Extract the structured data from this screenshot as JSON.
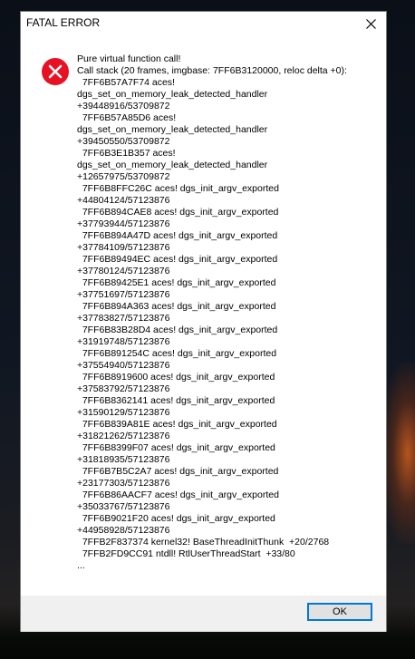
{
  "window": {
    "title": "FATAL ERROR"
  },
  "icons": {
    "close": "close-icon",
    "error": "error-icon"
  },
  "colors": {
    "error_red": "#e81123",
    "button_border": "#0078d7"
  },
  "message": {
    "lines": [
      "Pure virtual function call!",
      "Call stack (20 frames, imgbase: 7FF6B3120000, reloc delta +0):",
      "  7FF6B57A7F74 aces!",
      "dgs_set_on_memory_leak_detected_handler",
      "+39448916/53709872",
      "  7FF6B57A85D6 aces!",
      "dgs_set_on_memory_leak_detected_handler",
      "+39450550/53709872",
      "  7FF6B3E1B357 aces!",
      "dgs_set_on_memory_leak_detected_handler",
      "+12657975/53709872",
      "  7FF6B8FFC26C aces! dgs_init_argv_exported",
      "+44804124/57123876",
      "  7FF6B894CAE8 aces! dgs_init_argv_exported",
      "+37793944/57123876",
      "  7FF6B894A47D aces! dgs_init_argv_exported",
      "+37784109/57123876",
      "  7FF6B89494EC aces! dgs_init_argv_exported",
      "+37780124/57123876",
      "  7FF6B89425E1 aces! dgs_init_argv_exported",
      "+37751697/57123876",
      "  7FF6B894A363 aces! dgs_init_argv_exported",
      "+37783827/57123876",
      "  7FF6B83B28D4 aces! dgs_init_argv_exported",
      "+31919748/57123876",
      "  7FF6B891254C aces! dgs_init_argv_exported",
      "+37554940/57123876",
      "  7FF6B8919600 aces! dgs_init_argv_exported",
      "+37583792/57123876",
      "  7FF6B8362141 aces! dgs_init_argv_exported",
      "+31590129/57123876",
      "  7FF6B839A81E aces! dgs_init_argv_exported",
      "+31821262/57123876",
      "  7FF6B8399F07 aces! dgs_init_argv_exported",
      "+31818935/57123876",
      "  7FF6B7B5C2A7 aces! dgs_init_argv_exported",
      "+23177303/57123876",
      "  7FF6B86AACF7 aces! dgs_init_argv_exported",
      "+35033767/57123876",
      "  7FF6B9021F20 aces! dgs_init_argv_exported",
      "+44958928/57123876",
      "  7FFB2F837374 kernel32! BaseThreadInitThunk  +20/2768",
      "  7FFB2FD9CC91 ntdll! RtlUserThreadStart  +33/80",
      "..."
    ]
  },
  "buttons": {
    "ok_label": "OK"
  }
}
